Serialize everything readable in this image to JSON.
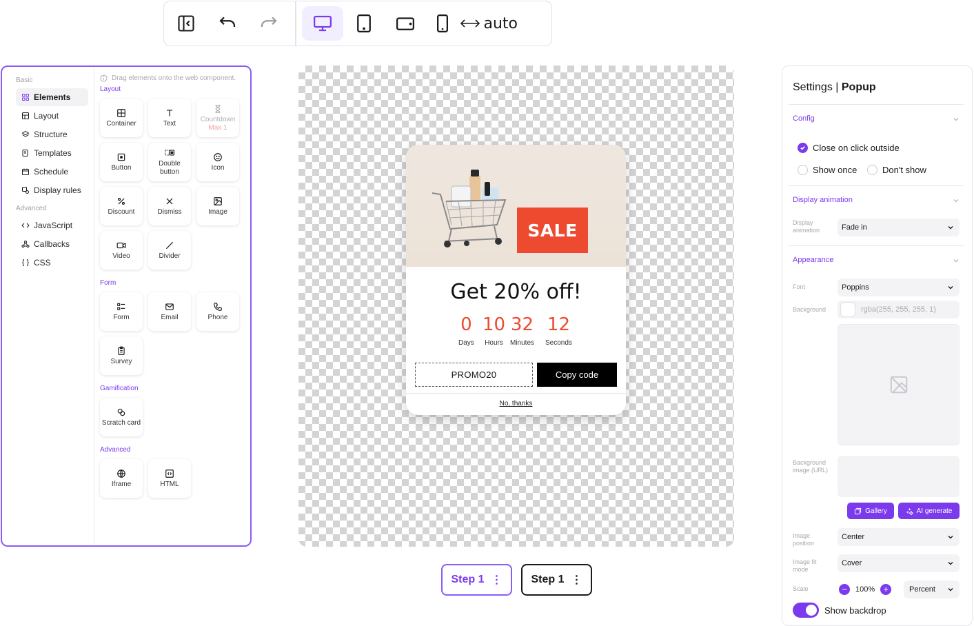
{
  "toolbar": {
    "width_mode": "auto",
    "icons": [
      "panel-collapse-icon",
      "undo-icon",
      "redo-icon",
      "desktop-icon",
      "tablet-portrait-icon",
      "tablet-landscape-icon",
      "mobile-icon",
      "width-arrows-icon"
    ]
  },
  "nav": {
    "basic_label": "Basic",
    "advanced_label": "Advanced",
    "items": [
      {
        "label": "Elements",
        "icon": "grid-icon",
        "active": true
      },
      {
        "label": "Layout",
        "icon": "layout-icon"
      },
      {
        "label": "Structure",
        "icon": "layers-icon"
      },
      {
        "label": "Templates",
        "icon": "templates-icon"
      },
      {
        "label": "Schedule",
        "icon": "calendar-icon"
      },
      {
        "label": "Display rules",
        "icon": "rules-icon"
      }
    ],
    "adv_items": [
      {
        "label": "JavaScript",
        "icon": "code-icon"
      },
      {
        "label": "Callbacks",
        "icon": "webhook-icon"
      },
      {
        "label": "CSS",
        "icon": "braces-icon"
      }
    ]
  },
  "palette": {
    "hint": "Drag elements onto the web component.",
    "sections": {
      "layout": "Layout",
      "form": "Form",
      "gamification": "Gamification",
      "advanced": "Advanced"
    },
    "layout_tiles": [
      "Container",
      "Text",
      "Countdown",
      "Button",
      "Double button",
      "Icon",
      "Discount",
      "Dismiss",
      "Image",
      "Video",
      "Divider"
    ],
    "countdown_sub": "Max 1",
    "form_tiles": [
      "Form",
      "Email",
      "Phone",
      "Survey"
    ],
    "gamification_tiles": [
      "Scratch card"
    ],
    "advanced_tiles": [
      "Iframe",
      "HTML"
    ]
  },
  "popup": {
    "sale_text": "SALE",
    "title": "Get 20% off!",
    "timer": [
      {
        "value": "0",
        "label": "Days"
      },
      {
        "value": "10",
        "label": "Hours"
      },
      {
        "value": "32",
        "label": "Minutes"
      },
      {
        "value": "12",
        "label": "Seconds"
      }
    ],
    "promo_code": "PROMO20",
    "copy_label": "Copy code",
    "no_thanks": "No, thanks",
    "accent_color": "#ee4a30"
  },
  "steps": [
    {
      "label": "Step 1",
      "active": true
    },
    {
      "label": "Step 1",
      "active": false
    }
  ],
  "settings": {
    "title_prefix": "Settings |",
    "title_bold": "Popup",
    "config_label": "Config",
    "close_outside": "Close on click outside",
    "show_once": "Show once",
    "dont_show": "Don't show",
    "display_animation_label": "Display animation",
    "display_animation_field": "Display animation",
    "display_animation_value": "Fade in",
    "appearance_label": "Appearance",
    "font_label": "Font",
    "font_value": "Poppins",
    "background_label": "Background",
    "background_value": "rgba(255, 255, 255, 1)",
    "bg_image_url_label": "Background image (URL)",
    "gallery_label": "Gallery",
    "ai_label": "AI generate",
    "image_position_label": "Image position",
    "image_position_value": "Center",
    "image_fit_label": "Image fit mode",
    "image_fit_value": "Cover",
    "scale_label": "Scale",
    "scale_value": "100%",
    "scale_unit": "Percent",
    "show_backdrop": "Show backdrop"
  },
  "colors": {
    "accent": "#7c3aed",
    "sale": "#ee4a30"
  }
}
